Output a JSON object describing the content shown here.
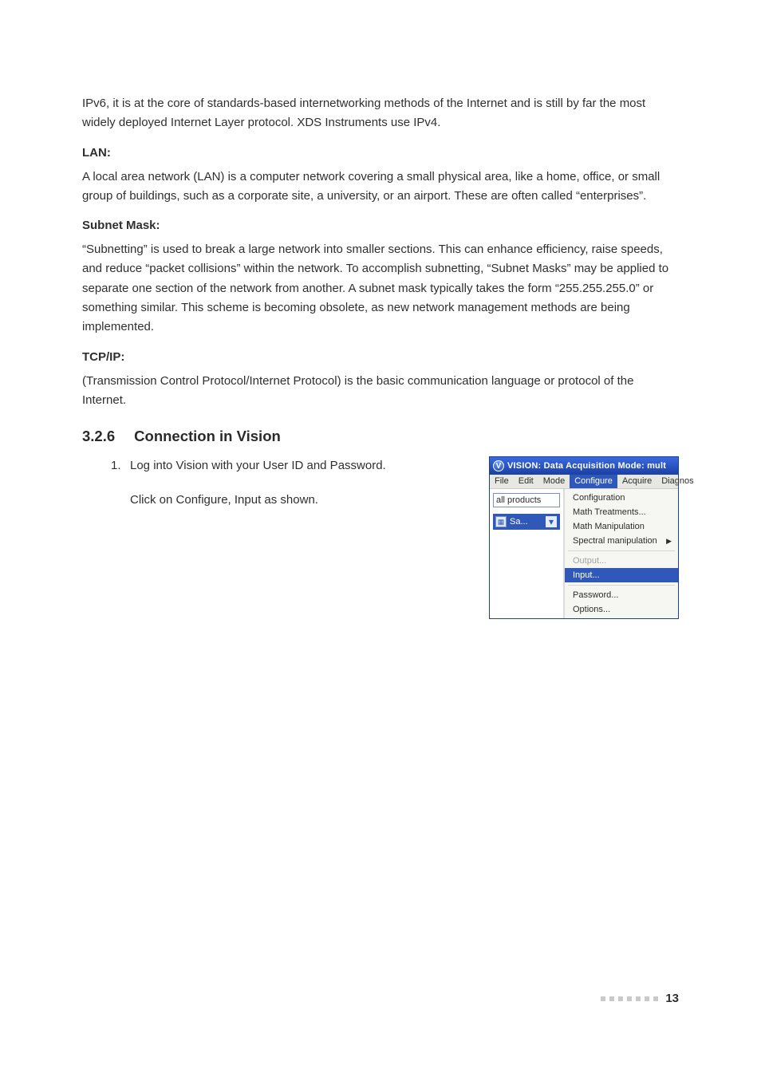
{
  "paragraphs": {
    "intro": "IPv6, it is at the core of standards-based internetworking methods of the Internet and is still by far the most widely deployed Internet Layer protocol. XDS Instruments use IPv4.",
    "lan_label": "LAN:",
    "lan_text": "A local area network (LAN) is a computer network covering a small physical area, like a home, office, or small group of buildings, such as a corporate site, a university, or an airport. These are often called “enterprises”.",
    "subnet_label": "Subnet Mask:",
    "subnet_text": "“Subnetting” is used to break a large network into smaller sections. This can enhance efficiency, raise speeds, and reduce “packet collisions” within the network. To accomplish subnetting, “Subnet Masks” may be applied to separate one section of the network from another. A subnet mask typically takes the form “255.255.255.0” or something similar. This scheme is becoming obsolete, as new network management methods are being implemented.",
    "tcpip_label": "TCP/IP:",
    "tcpip_text": "(Transmission Control Protocol/Internet Protocol) is the basic communication language or protocol of the Internet."
  },
  "section": {
    "number": "3.2.6",
    "title": "Connection in Vision"
  },
  "step": {
    "num": "1.",
    "line1": "Log into Vision with your User ID and Password.",
    "line2": "Click on Configure, Input as shown."
  },
  "vision": {
    "title_logo_letter": "V",
    "title_text": "VISION: Data Acquisition Mode: mult",
    "menu": {
      "file": "File",
      "edit": "Edit",
      "mode": "Mode",
      "configure": "Configure",
      "acquire": "Acquire",
      "diagnos": "Diagnos"
    },
    "left_panel": {
      "input_value": "all products",
      "selected_doc_label": "Sa..."
    },
    "dropdown": {
      "configuration": "Configuration",
      "math_treatments": "Math Treatments...",
      "math_manipulation": "Math Manipulation",
      "spectral_manipulation": "Spectral manipulation",
      "output": "Output...",
      "input": "Input...",
      "password": "Password...",
      "options": "Options..."
    }
  },
  "footer": {
    "page_number": "13"
  }
}
